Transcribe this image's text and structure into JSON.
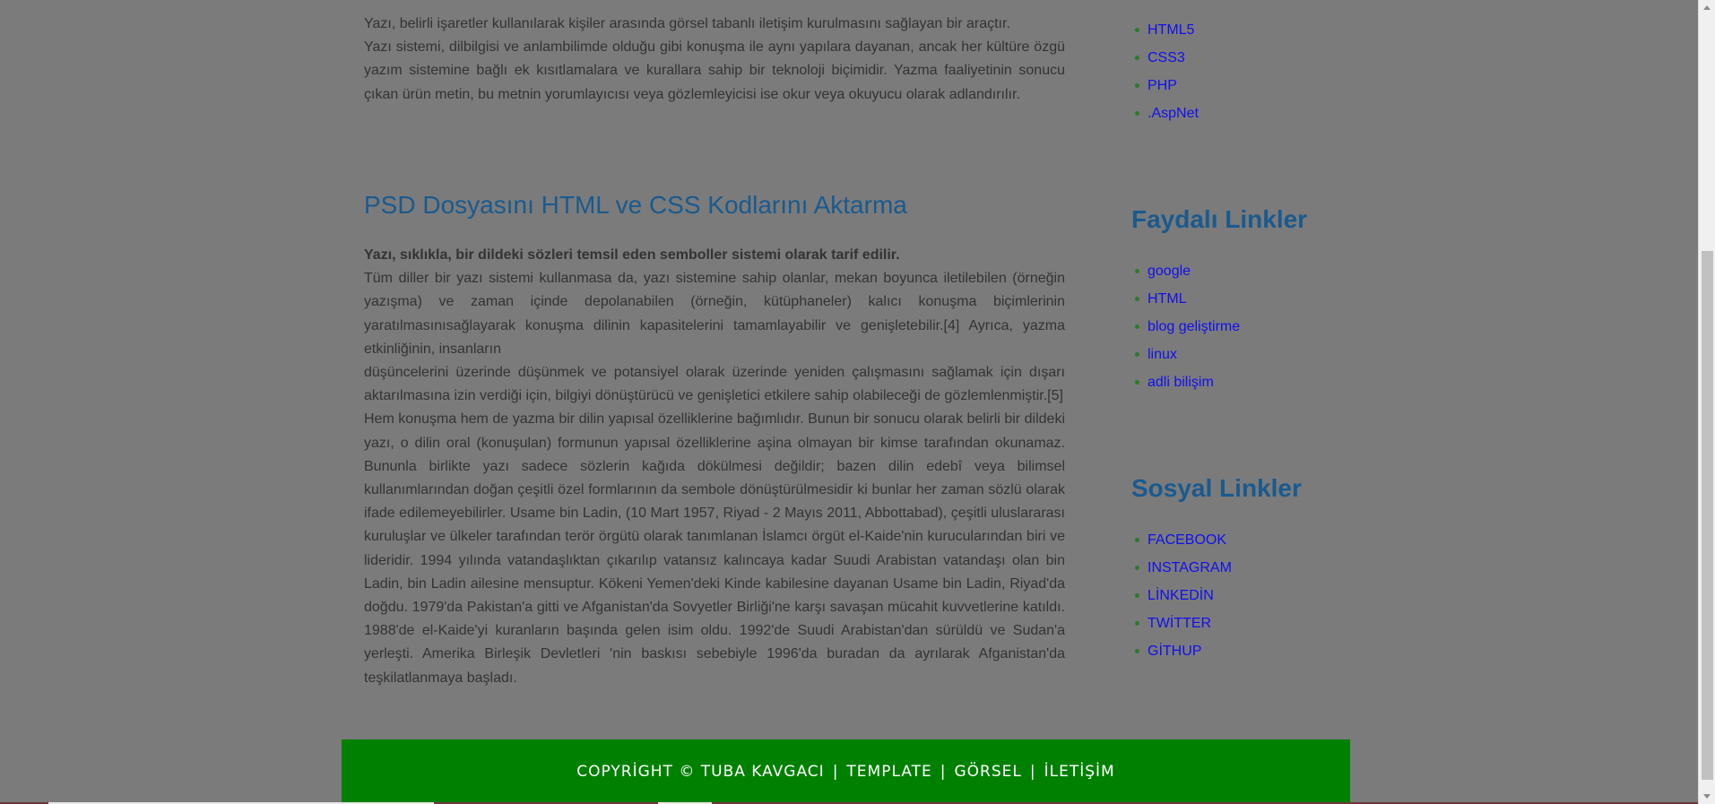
{
  "content": {
    "intro_p1": "Yazı, belirli işaretler kullanılarak kişiler arasında görsel tabanlı iletişim kurulmasını sağlayan bir araçtır.",
    "intro_p2": "Yazı sistemi, dilbilgisi ve anlambilimde olduğu gibi konuşma ile aynı yapılara dayanan, ancak her kültüre özgü yazım sistemine bağlı ek kısıtlamalara ve kurallara sahip bir teknoloji biçimidir. Yazma faaliyetinin sonucu çıkan ürün metin, bu metnin yorumlayıcısı veya gözlemleyicisi ise okur veya okuyucu olarak adlandırılır.",
    "article_title": "PSD Dosyasını HTML ve CSS Kodlarını Aktarma",
    "article_lead": "Yazı, sıklıkla, bir dildeki sözleri temsil eden semboller sistemi olarak tarif edilir.",
    "article_p1": "Tüm diller bir yazı sistemi kullanmasa da, yazı sistemine sahip olanlar, mekan boyunca iletilebilen (örneğin yazışma) ve zaman içinde depolanabilen (örneğin, kütüphaneler) kalıcı konuşma biçimlerinin yaratılmasınısağlayarak konuşma dilinin kapasitelerini tamamlayabilir ve genişletebilir.[4] Ayrıca, yazma etkinliğinin, insanların",
    "article_p2": "düşüncelerini üzerinde düşünmek ve potansiyel olarak üzerinde yeniden çalışmasını sağlamak için dışarı aktarılmasına izin verdiği için, bilgiyi dönüştürücü ve genişletici etkilere sahip olabileceği de gözlemlenmiştir.[5]",
    "article_p3": "Hem konuşma hem de yazma bir dilin yapısal özelliklerine bağımlıdır. Bunun bir sonucu olarak belirli bir dildeki yazı, o dilin oral (konuşulan) formunun yapısal özelliklerine aşina olmayan bir kimse tarafından okunamaz. Bununla birlikte yazı sadece sözlerin kağıda dökülmesi değildir; bazen dilin edebî veya bilimsel kullanımlarından doğan çeşitli özel formlarının da sembole dönüştürülmesidir ki bunlar her zaman sözlü olarak ifade edilemeyebilirler. Usame bin Ladin, (10 Mart 1957, Riyad - 2 Mayıs 2011, Abbottabad), çeşitli uluslararası kuruluşlar ve ülkeler tarafından terör örgütü olarak tanımlanan İslamcı örgüt el-Kaide'nin kurucularından biri ve lideridir. 1994 yılında vatandaşlıktan çıkarılıp vatansız kalıncaya kadar Suudi Arabistan vatandaşı olan bin Ladin, bin Ladin ailesine mensuptur. Kökeni Yemen'deki Kinde kabilesine dayanan Usame bin Ladin, Riyad'da doğdu. 1979'da Pakistan'a gitti ve Afganistan'da Sovyetler Birliği'ne karşı savaşan mücahit kuvvetlerine katıldı. 1988'de el-Kaide'yi kuranların başında gelen isim oldu. 1992'de Suudi Arabistan'dan sürüldü ve Sudan'a yerleşti. Amerika Birleşik Devletleri 'nin baskısı sebebiyle 1996'da buradan da ayrılarak Afganistan'da teşkilatlanmaya başladı."
  },
  "sidebar": {
    "topics": [
      "HTML5",
      "CSS3",
      "PHP",
      ".AspNet"
    ],
    "useful_title": "Faydalı Linkler",
    "useful_links": [
      "google",
      "HTML",
      "blog geliştirme",
      "linux",
      "adli bilişim"
    ],
    "social_title": "Sosyal Linkler",
    "social_links": [
      "FACEBOOK",
      "INSTAGRAM",
      "LİNKEDİN",
      "TWİTTER",
      "GİTHUP"
    ]
  },
  "footer": {
    "copyright": "COPYRİGHT © TUBA KAVGACI",
    "sep": "|",
    "link1": "TEMPLATE",
    "link2": "GÖRSEL",
    "link3": "İLETİŞİM"
  },
  "colors": {
    "overlay_bg": "#7b7b7b",
    "heading": "#1a5a8e",
    "link": "#1010ee",
    "footer_bg": "#008000"
  }
}
